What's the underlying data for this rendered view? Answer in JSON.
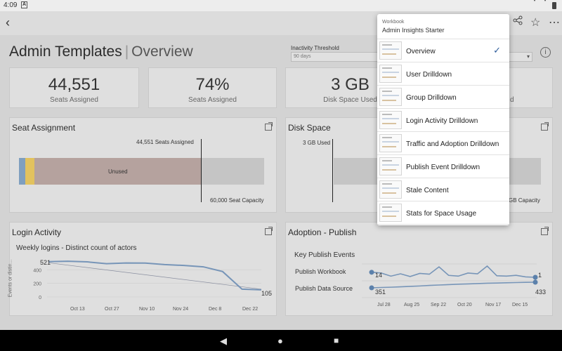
{
  "status_bar": {
    "time": "4:09",
    "app_icon": "A"
  },
  "dashboard": {
    "title": "Admin Templates",
    "separator": "|",
    "subtitle": "Overview"
  },
  "inactivity": {
    "label": "Inactivity Threshold",
    "value": "90 days"
  },
  "kpis": [
    {
      "value": "44,551",
      "label": "Seats Assigned"
    },
    {
      "value": "74%",
      "label": "Seats Assigned"
    },
    {
      "value": "3 GB",
      "label": "Disk Space Used"
    },
    {
      "label_fragment": "d"
    }
  ],
  "seat_assignment": {
    "title": "Seat Assignment",
    "assigned_label": "44,551 Seats Assigned",
    "unused_label": "Unused",
    "capacity_label": "60,000 Seat Capacity",
    "colors": {
      "seg1": "#7f9fbf",
      "seg2": "#e2c25e",
      "seg3": "#b5a29e",
      "bg": "#c5c5c5"
    }
  },
  "disk_space": {
    "title": "Disk Space",
    "used_label": "3 GB Used",
    "capacity_fragment": "GB Capacity"
  },
  "login_activity": {
    "title": "Login Activity",
    "chart_title": "Weekly logins - Distinct count of actors",
    "y_label": "Events or distin...",
    "start_label": "521",
    "end_label": "105"
  },
  "adoption_publish": {
    "title": "Adoption - Publish",
    "subtitle": "Key Publish Events",
    "row1_label": "Publish Workbook",
    "row1_start": "14",
    "row1_end": "1",
    "row2_label": "Publish Data Source",
    "row2_start": "351",
    "row2_end": "433"
  },
  "chart_data": [
    {
      "type": "line",
      "title": "Weekly logins - Distinct count of actors",
      "ylabel": "Events or distin...",
      "x_ticks": [
        "Oct 13",
        "Oct 27",
        "Nov 10",
        "Nov 24",
        "Dec 8",
        "Dec 22"
      ],
      "y_ticks": [
        0,
        200,
        400
      ],
      "ylim": [
        0,
        560
      ],
      "series": [
        {
          "values": [
            521,
            528,
            518,
            491,
            502,
            500,
            478,
            465,
            445,
            375,
            115,
            105
          ]
        }
      ],
      "trend": [
        505,
        115
      ]
    },
    {
      "type": "line",
      "title": "Key Publish Events",
      "x_ticks": [
        "Jul 28",
        "Aug 25",
        "Sep 22",
        "Oct 20",
        "Nov 17",
        "Dec 15"
      ],
      "series": [
        {
          "name": "Publish Workbook",
          "values": [
            14,
            12,
            4,
            10,
            3,
            11,
            9,
            28,
            6,
            4,
            12,
            10,
            30,
            5,
            4,
            6,
            2,
            1
          ]
        },
        {
          "name": "Publish Data Source",
          "values": [
            351,
            356,
            360,
            366,
            372,
            378,
            386,
            392,
            398,
            404,
            408,
            413,
            418,
            421,
            425,
            428,
            431,
            433
          ]
        }
      ]
    }
  ],
  "workbook_menu": {
    "header_label": "Workbook",
    "workbook_name": "Admin Insights Starter",
    "items": [
      {
        "label": "Overview",
        "selected": true
      },
      {
        "label": "User Drilldown"
      },
      {
        "label": "Group Drilldown"
      },
      {
        "label": "Login Activity Drilldown"
      },
      {
        "label": "Traffic and Adoption Drilldown"
      },
      {
        "label": "Publish Event Drilldown"
      },
      {
        "label": "Stale Content"
      },
      {
        "label": "Stats for Space Usage"
      }
    ]
  },
  "icons": {
    "back": "back-arrow-icon",
    "share": "share-icon",
    "favorite": "star-icon",
    "more": "more-icon",
    "info": "info-icon",
    "expand": "expand-icon",
    "check": "checkmark-icon"
  }
}
